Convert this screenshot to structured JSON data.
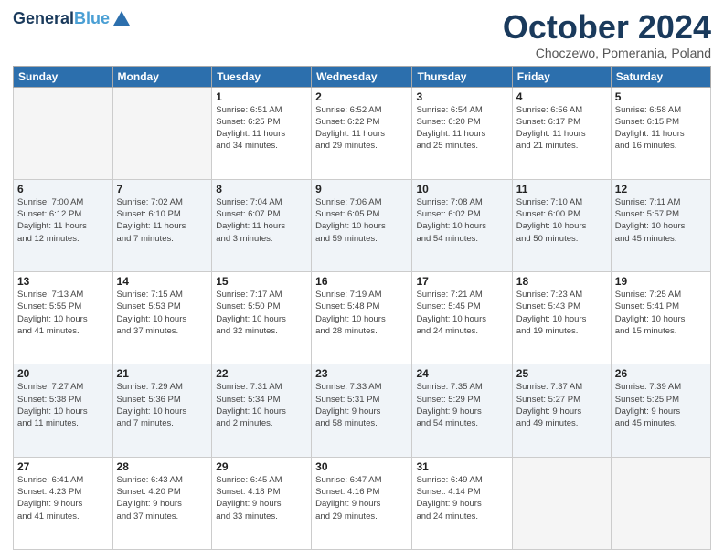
{
  "logo": {
    "line1": "General",
    "line1_colored": "Blue",
    "line2": ""
  },
  "header": {
    "month": "October 2024",
    "location": "Choczewo, Pomerania, Poland"
  },
  "days_of_week": [
    "Sunday",
    "Monday",
    "Tuesday",
    "Wednesday",
    "Thursday",
    "Friday",
    "Saturday"
  ],
  "weeks": [
    [
      {
        "day": "",
        "detail": ""
      },
      {
        "day": "",
        "detail": ""
      },
      {
        "day": "1",
        "detail": "Sunrise: 6:51 AM\nSunset: 6:25 PM\nDaylight: 11 hours\nand 34 minutes."
      },
      {
        "day": "2",
        "detail": "Sunrise: 6:52 AM\nSunset: 6:22 PM\nDaylight: 11 hours\nand 29 minutes."
      },
      {
        "day": "3",
        "detail": "Sunrise: 6:54 AM\nSunset: 6:20 PM\nDaylight: 11 hours\nand 25 minutes."
      },
      {
        "day": "4",
        "detail": "Sunrise: 6:56 AM\nSunset: 6:17 PM\nDaylight: 11 hours\nand 21 minutes."
      },
      {
        "day": "5",
        "detail": "Sunrise: 6:58 AM\nSunset: 6:15 PM\nDaylight: 11 hours\nand 16 minutes."
      }
    ],
    [
      {
        "day": "6",
        "detail": "Sunrise: 7:00 AM\nSunset: 6:12 PM\nDaylight: 11 hours\nand 12 minutes."
      },
      {
        "day": "7",
        "detail": "Sunrise: 7:02 AM\nSunset: 6:10 PM\nDaylight: 11 hours\nand 7 minutes."
      },
      {
        "day": "8",
        "detail": "Sunrise: 7:04 AM\nSunset: 6:07 PM\nDaylight: 11 hours\nand 3 minutes."
      },
      {
        "day": "9",
        "detail": "Sunrise: 7:06 AM\nSunset: 6:05 PM\nDaylight: 10 hours\nand 59 minutes."
      },
      {
        "day": "10",
        "detail": "Sunrise: 7:08 AM\nSunset: 6:02 PM\nDaylight: 10 hours\nand 54 minutes."
      },
      {
        "day": "11",
        "detail": "Sunrise: 7:10 AM\nSunset: 6:00 PM\nDaylight: 10 hours\nand 50 minutes."
      },
      {
        "day": "12",
        "detail": "Sunrise: 7:11 AM\nSunset: 5:57 PM\nDaylight: 10 hours\nand 45 minutes."
      }
    ],
    [
      {
        "day": "13",
        "detail": "Sunrise: 7:13 AM\nSunset: 5:55 PM\nDaylight: 10 hours\nand 41 minutes."
      },
      {
        "day": "14",
        "detail": "Sunrise: 7:15 AM\nSunset: 5:53 PM\nDaylight: 10 hours\nand 37 minutes."
      },
      {
        "day": "15",
        "detail": "Sunrise: 7:17 AM\nSunset: 5:50 PM\nDaylight: 10 hours\nand 32 minutes."
      },
      {
        "day": "16",
        "detail": "Sunrise: 7:19 AM\nSunset: 5:48 PM\nDaylight: 10 hours\nand 28 minutes."
      },
      {
        "day": "17",
        "detail": "Sunrise: 7:21 AM\nSunset: 5:45 PM\nDaylight: 10 hours\nand 24 minutes."
      },
      {
        "day": "18",
        "detail": "Sunrise: 7:23 AM\nSunset: 5:43 PM\nDaylight: 10 hours\nand 19 minutes."
      },
      {
        "day": "19",
        "detail": "Sunrise: 7:25 AM\nSunset: 5:41 PM\nDaylight: 10 hours\nand 15 minutes."
      }
    ],
    [
      {
        "day": "20",
        "detail": "Sunrise: 7:27 AM\nSunset: 5:38 PM\nDaylight: 10 hours\nand 11 minutes."
      },
      {
        "day": "21",
        "detail": "Sunrise: 7:29 AM\nSunset: 5:36 PM\nDaylight: 10 hours\nand 7 minutes."
      },
      {
        "day": "22",
        "detail": "Sunrise: 7:31 AM\nSunset: 5:34 PM\nDaylight: 10 hours\nand 2 minutes."
      },
      {
        "day": "23",
        "detail": "Sunrise: 7:33 AM\nSunset: 5:31 PM\nDaylight: 9 hours\nand 58 minutes."
      },
      {
        "day": "24",
        "detail": "Sunrise: 7:35 AM\nSunset: 5:29 PM\nDaylight: 9 hours\nand 54 minutes."
      },
      {
        "day": "25",
        "detail": "Sunrise: 7:37 AM\nSunset: 5:27 PM\nDaylight: 9 hours\nand 49 minutes."
      },
      {
        "day": "26",
        "detail": "Sunrise: 7:39 AM\nSunset: 5:25 PM\nDaylight: 9 hours\nand 45 minutes."
      }
    ],
    [
      {
        "day": "27",
        "detail": "Sunrise: 6:41 AM\nSunset: 4:23 PM\nDaylight: 9 hours\nand 41 minutes."
      },
      {
        "day": "28",
        "detail": "Sunrise: 6:43 AM\nSunset: 4:20 PM\nDaylight: 9 hours\nand 37 minutes."
      },
      {
        "day": "29",
        "detail": "Sunrise: 6:45 AM\nSunset: 4:18 PM\nDaylight: 9 hours\nand 33 minutes."
      },
      {
        "day": "30",
        "detail": "Sunrise: 6:47 AM\nSunset: 4:16 PM\nDaylight: 9 hours\nand 29 minutes."
      },
      {
        "day": "31",
        "detail": "Sunrise: 6:49 AM\nSunset: 4:14 PM\nDaylight: 9 hours\nand 24 minutes."
      },
      {
        "day": "",
        "detail": ""
      },
      {
        "day": "",
        "detail": ""
      }
    ]
  ]
}
